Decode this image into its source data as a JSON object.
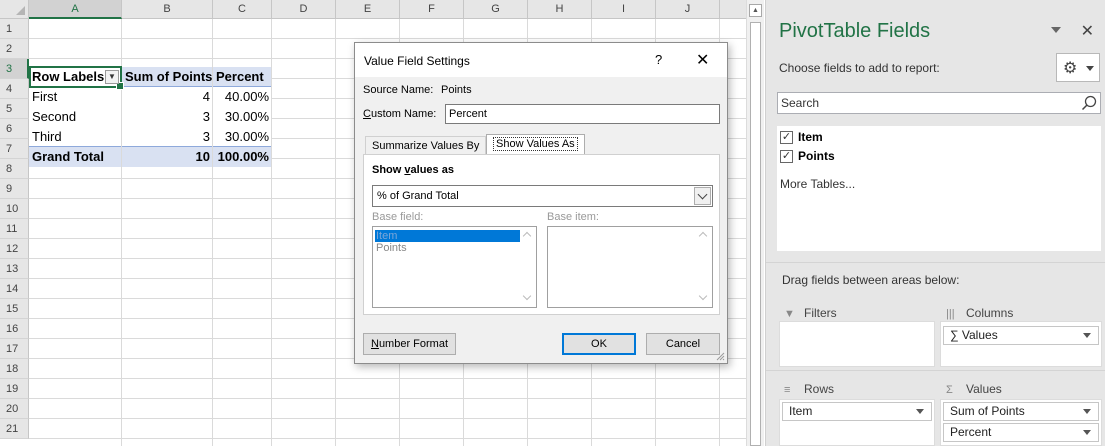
{
  "sheet": {
    "columns": [
      "A",
      "B",
      "C",
      "D",
      "E",
      "F",
      "G",
      "H",
      "I",
      "J"
    ],
    "rows": [
      "1",
      "2",
      "3",
      "4",
      "5",
      "6",
      "7",
      "8",
      "9",
      "10",
      "11",
      "12",
      "13",
      "14",
      "15",
      "16",
      "17",
      "18",
      "19",
      "20",
      "21"
    ],
    "pivot": {
      "header": [
        "Row Labels",
        "Sum of Points",
        "Percent"
      ],
      "rows": [
        [
          "First",
          "4",
          "40.00%"
        ],
        [
          "Second",
          "3",
          "30.00%"
        ],
        [
          "Third",
          "3",
          "30.00%"
        ]
      ],
      "total": [
        "Grand Total",
        "10",
        "100.00%"
      ]
    }
  },
  "dialog": {
    "title": "Value Field Settings",
    "help": "?",
    "close": "✕",
    "source_label": "Source Name:",
    "source_value": "Points",
    "custom_label_prefix": "",
    "custom_label_u": "C",
    "custom_label_rest": "ustom Name:",
    "custom_value": "Percent",
    "tabs": [
      "Summarize Values By",
      "Show Values As"
    ],
    "show_values_as_label_a": "Show ",
    "show_values_as_label_u": "v",
    "show_values_as_label_b": "alues as",
    "show_values_as_value": "% of Grand Total",
    "base_field_label": "Base field:",
    "base_item_label": "Base item:",
    "base_fields": [
      "Item",
      "Points"
    ],
    "number_format_u": "N",
    "number_format_rest": "umber Format",
    "ok": "OK",
    "cancel": "Cancel"
  },
  "pane": {
    "title": "PivotTable Fields",
    "choose": "Choose fields to add to report:",
    "search_placeholder": "Search",
    "fields": [
      {
        "name": "Item",
        "checked": "✓"
      },
      {
        "name": "Points",
        "checked": "✓"
      }
    ],
    "more_tables": "More Tables...",
    "drag_label": "Drag fields between areas below:",
    "areas": {
      "filters": "Filters",
      "columns": "Columns",
      "rows": "Rows",
      "values": "Values"
    },
    "columns_items": [
      "∑ Values"
    ],
    "rows_items": [
      "Item"
    ],
    "values_items": [
      "Sum of Points",
      "Percent"
    ]
  },
  "colors": {
    "excel_green": "#217346",
    "pivot_band": "#d9e1f2",
    "selection_blue": "#0078d7"
  }
}
